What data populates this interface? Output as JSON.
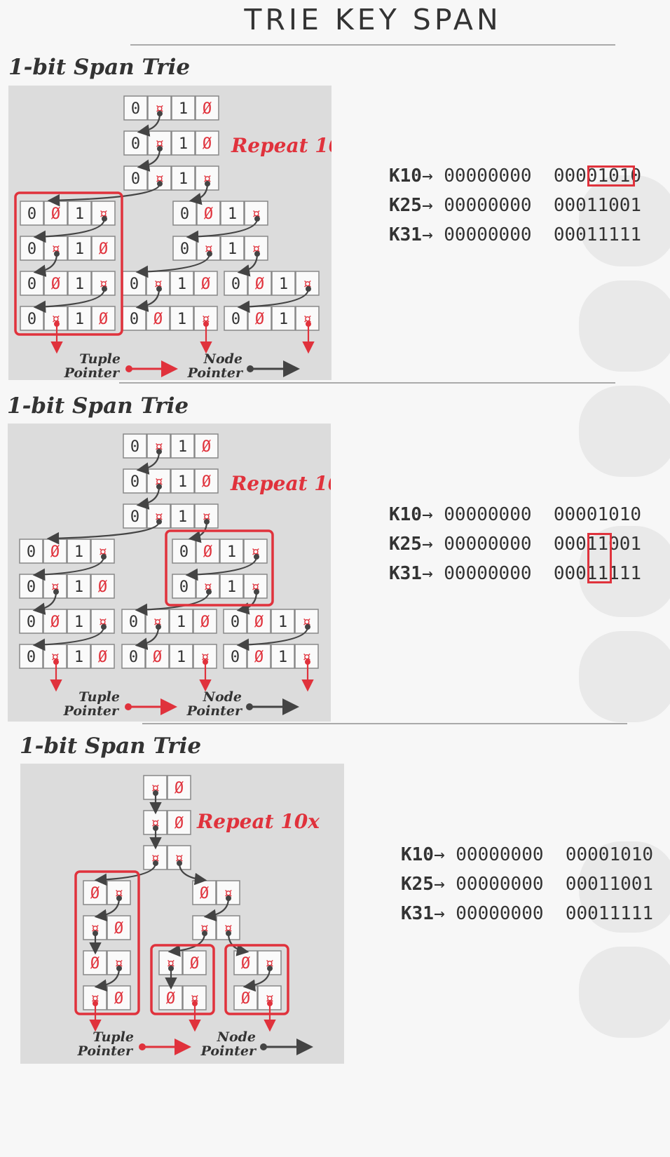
{
  "page_title": "TRIE KEY SPAN",
  "section_title": "1-bit Span Trie",
  "repeat_label": "Repeat 10x",
  "legend": {
    "tuple_label_1": "Tuple",
    "tuple_label_2": "Pointer",
    "node_label_1": "Node",
    "node_label_2": "Pointer"
  },
  "keys": [
    {
      "name": "K10",
      "arrow": "→",
      "high": "00000000",
      "low": "00001010"
    },
    {
      "name": "K25",
      "arrow": "→",
      "high": "00000000",
      "low": "00011001"
    },
    {
      "name": "K31",
      "arrow": "→",
      "high": "00000000",
      "low": "00011111"
    }
  ],
  "colors": {
    "accent": "#e0323c",
    "node_pointer": "#444444",
    "panel": "#dcdcdc"
  },
  "symbols": {
    "zero": "0",
    "one": "1",
    "empty": "Ø",
    "pointer": "¤"
  }
}
